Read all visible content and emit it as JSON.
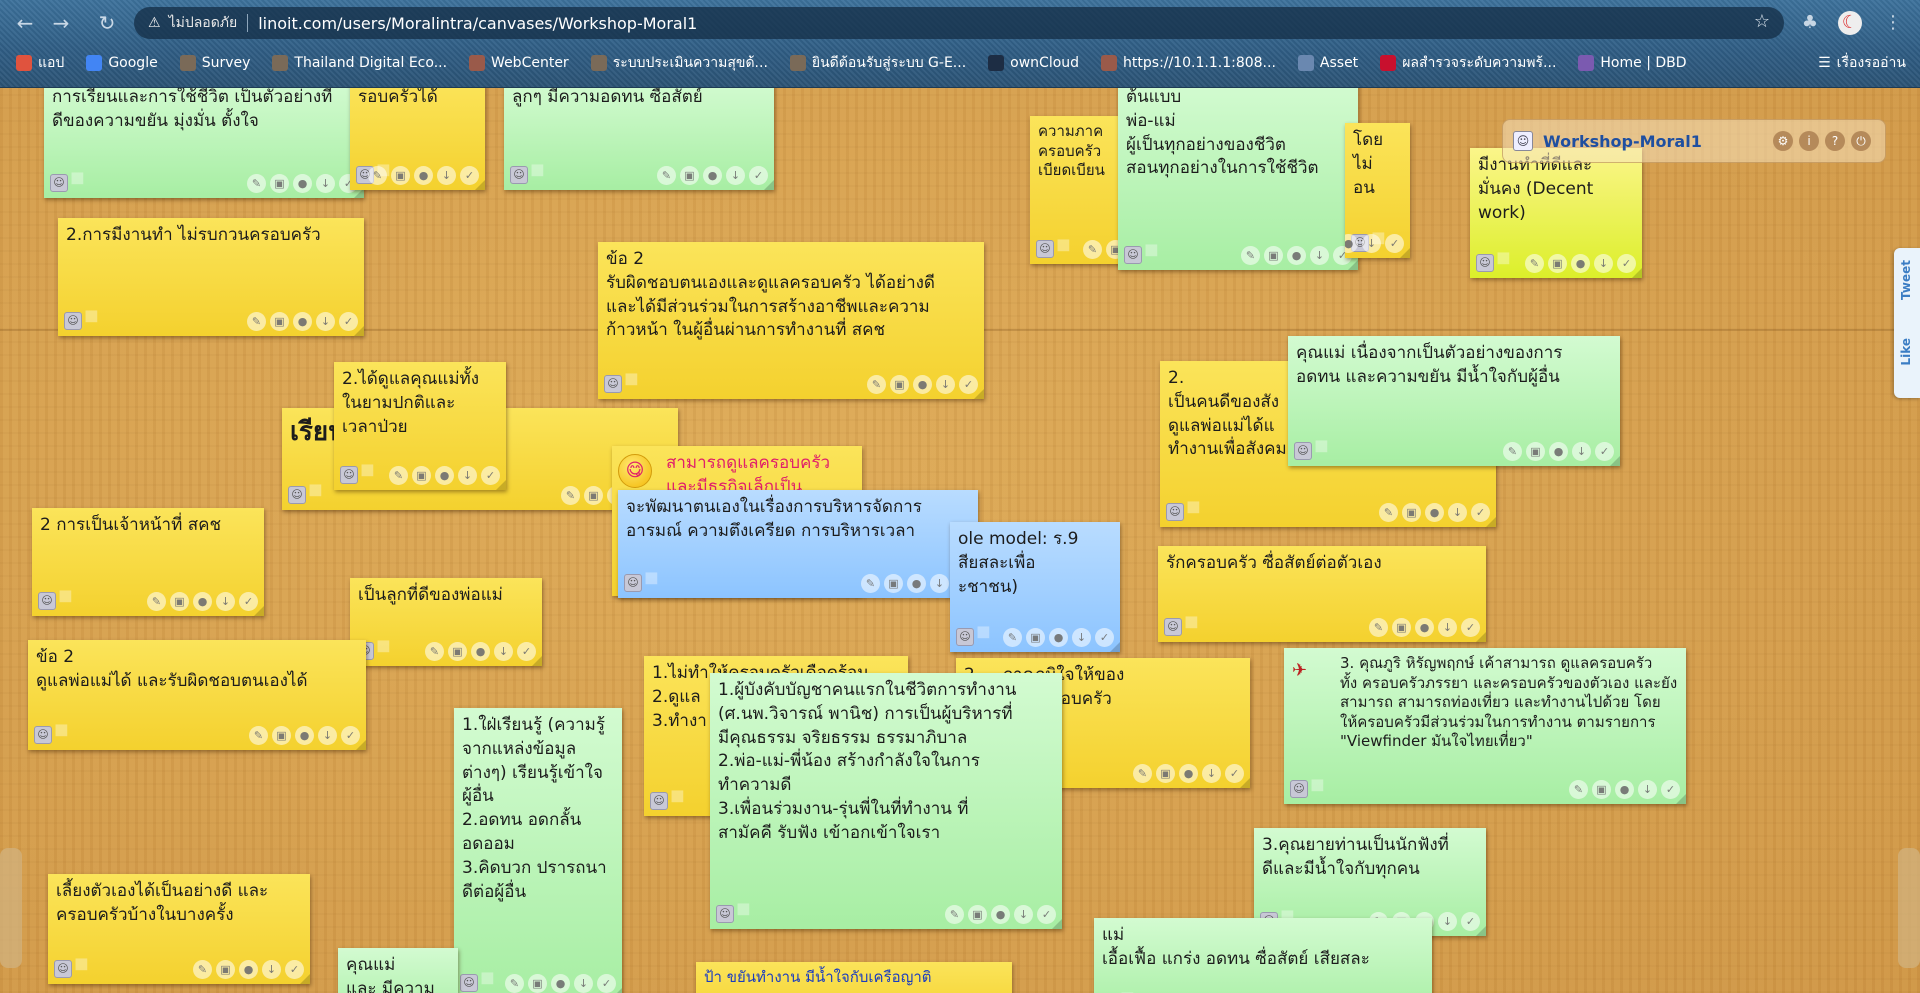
{
  "browser": {
    "insecure_label": "ไม่ปลอดภัย",
    "url": "linoit.com/users/Moralintra/canvases/Workshop-Moral1",
    "bookmarks": [
      {
        "label": "แอป",
        "color": "#e0533e"
      },
      {
        "label": "Google",
        "color": "#4285f4"
      },
      {
        "label": "Survey",
        "color": "#7a6a58"
      },
      {
        "label": "Thailand Digital Eco...",
        "color": "#7a6a58"
      },
      {
        "label": "WebCenter",
        "color": "#9a5a4a"
      },
      {
        "label": "ระบบประเมินความสุขด้...",
        "color": "#7a6a58"
      },
      {
        "label": "ยินดีต้อนรับสู่ระบบ G-E...",
        "color": "#7a6a58"
      },
      {
        "label": "ownCloud",
        "color": "#1d2d44"
      },
      {
        "label": "https://10.1.1.1:808...",
        "color": "#9a5a4a"
      },
      {
        "label": "Asset",
        "color": "#6a88b0"
      },
      {
        "label": "ผลสำรวจระดับความพร้...",
        "color": "#c8102e"
      },
      {
        "label": "Home | DBD",
        "color": "#7b5ab0"
      }
    ],
    "other_bookmarks": "เรื่องรออ่าน"
  },
  "canvas": {
    "title": "Workshop-Moral1"
  },
  "social": {
    "tweet": "Tweet",
    "like": "Like"
  },
  "notes": [
    {
      "id": "n1",
      "color": "green",
      "text": "การเรียนและการใช้ชีวิต เป็นตัวอย่างที่\nดีของความขยัน มุ่งมั่น ตั้งใจ"
    },
    {
      "id": "n2",
      "color": "yellow",
      "text": "รอบครัวได้"
    },
    {
      "id": "n3",
      "color": "green",
      "text": "ลูกๆ มีความอดทน ซื่อสัตย์"
    },
    {
      "id": "n4",
      "color": "yellow",
      "text": "2.การมีงานทำ ไม่รบกวนครอบครัว"
    },
    {
      "id": "n5",
      "color": "yellow",
      "text": "ข้อ 2\nรับผิดชอบตนเองและดูแลครอบครัว ได้อย่างดี\nและได้มีส่วนร่วมในการสร้างอาชีพและความ\nก้าวหน้า ในผู้อื่นผ่านการทำงานที่ สคช"
    },
    {
      "id": "n6",
      "color": "yellow",
      "text": "ความภาค\nครอบครัว\nเบียดเบียน"
    },
    {
      "id": "n7",
      "color": "green",
      "text": "ต้นแบบ\nพ่อ-แม่\nผู้เป็นทุกอย่างของชีวิต\nสอนทุกอย่างในการใช้ชีวิต"
    },
    {
      "id": "n8",
      "color": "yellow",
      "text": "โดยไม่\nอน"
    },
    {
      "id": "n9",
      "color": "lime",
      "text": "มีงานทำที่ดีและ\nมั่นคง (Decent\nwork)"
    },
    {
      "id": "n10",
      "color": "yellow",
      "text": "เรียน                ดูแลพ่อแม่"
    },
    {
      "id": "n11",
      "color": "yellow",
      "text": "2.ได้ดูแลคุณแม่ทั้ง\nในยามปกติและ\nเวลาป่วย"
    },
    {
      "id": "n12",
      "color": "yellow",
      "text": "สามารถดูแลครอบครัว\nและมีธุรกิจเล็กเป็น"
    },
    {
      "id": "n13",
      "color": "blue",
      "text": "จะพัฒนาตนเองในเรื่องการบริหารจัดการ\nอารมณ์ ความตึงเครียด การบริหารเวลา"
    },
    {
      "id": "n14",
      "color": "blue",
      "text": "ole model: ร.9\nสียสละเพื่อ\nะชาชน)"
    },
    {
      "id": "n15",
      "color": "yellow",
      "text": "2.\nเป็นคนดีของสัง\nดูแลพ่อแม่ได้แ\nทำงานเพื่อสังคมและประเทศชาติ"
    },
    {
      "id": "n16",
      "color": "green",
      "text": "คุณแม่ เนื่องจากเป็นตัวอย่างของการ\nอดทน และความขยัน มีน้ำใจกับผู้อื่น"
    },
    {
      "id": "n17",
      "color": "yellow",
      "text": "2 การเป็นเจ้าหน้าที่ สคช"
    },
    {
      "id": "n18",
      "color": "yellow",
      "text": "เป็นลูกที่ดีของพ่อแม่"
    },
    {
      "id": "n19",
      "color": "yellow",
      "text": "รักครอบครัว ซื่อสัตย์ต่อตัวเอง"
    },
    {
      "id": "n20",
      "color": "yellow",
      "text": "ข้อ 2\n ดูแลพ่อแม่ได้ และรับผิดชอบตนเองได้"
    },
    {
      "id": "n21",
      "color": "yellow",
      "text": "1.ไม่ทำให้ครอบครัวเดือดร้อน\n2.ดูแล\n3.ทำงา"
    },
    {
      "id": "n22",
      "color": "yellow",
      "text": "2. ...ภาคภูมิใจให้ของ\n...ไม่ทำให้ครอบครัว"
    },
    {
      "id": "n23",
      "color": "green",
      "text": "1.ผู้บังคับบัญชาคนแรกในชีวิตการทำงาน\n(ศ.นพ.วิจารณ์ พานิช) การเป็นผู้บริหารที่\nมีคุณธรรม จริยธรรม ธรรมาภิบาล\n2.พ่อ-แม่-พี่น้อง สร้างกำลังใจในการ\nทำความดี\n3.เพื่อนร่วมงาน-รุ่นพี่ในที่ทำงาน ที่\nสามัคคี รับฟัง เข้าอกเข้าใจเรา"
    },
    {
      "id": "n24",
      "color": "green",
      "text": "3. คุณภูริ หิรัญพฤกษ์ เค้าสามารถ ดูแลครอบครัว\nทั้ง ครอบครัวภรรยา และครอบครัวของตัวเอง และยัง\nสามารถ สามารถท่องเที่ยว และทำงานไปด้วย โดย\nให้ครอบครัวมีส่วนร่วมในการทำงาน ตามรายการ\n\"Viewfinder มันใจไทยเที่ยว\""
    },
    {
      "id": "n25",
      "color": "green",
      "text": "1.ใฝ่เรียนรู้ (ความรู้\nจากแหล่งข้อมูล\nต่างๆ) เรียนรู้เข้าใจ\nผู้อื่น\n2.อดทน อดกลั้น\nอดออม\n3.คิดบวก ปรารถนา\nดีต่อผู้อื่น"
    },
    {
      "id": "n26",
      "color": "green",
      "text": "3.คุณยายท่านเป็นนักฟังที่\nดีและมีน้ำใจกับทุกคน"
    },
    {
      "id": "n27",
      "color": "yellow",
      "text": "เลี้ยงตัวเองได้เป็นอย่างดี และ\nครอบครัวบ้างในบางครั้ง"
    },
    {
      "id": "n28",
      "color": "green",
      "text": "คุณแม่\nและ มีความ"
    },
    {
      "id": "n29",
      "color": "yellow",
      "text": "ป้า ขยันทำงาน มีน้ำใจกับเครือญาติ"
    },
    {
      "id": "n30",
      "color": "green",
      "text": "แม่\nเอื้อเฟื้อ แกร่ง อดทน ซื่อสัตย์ เสียสละ"
    }
  ]
}
